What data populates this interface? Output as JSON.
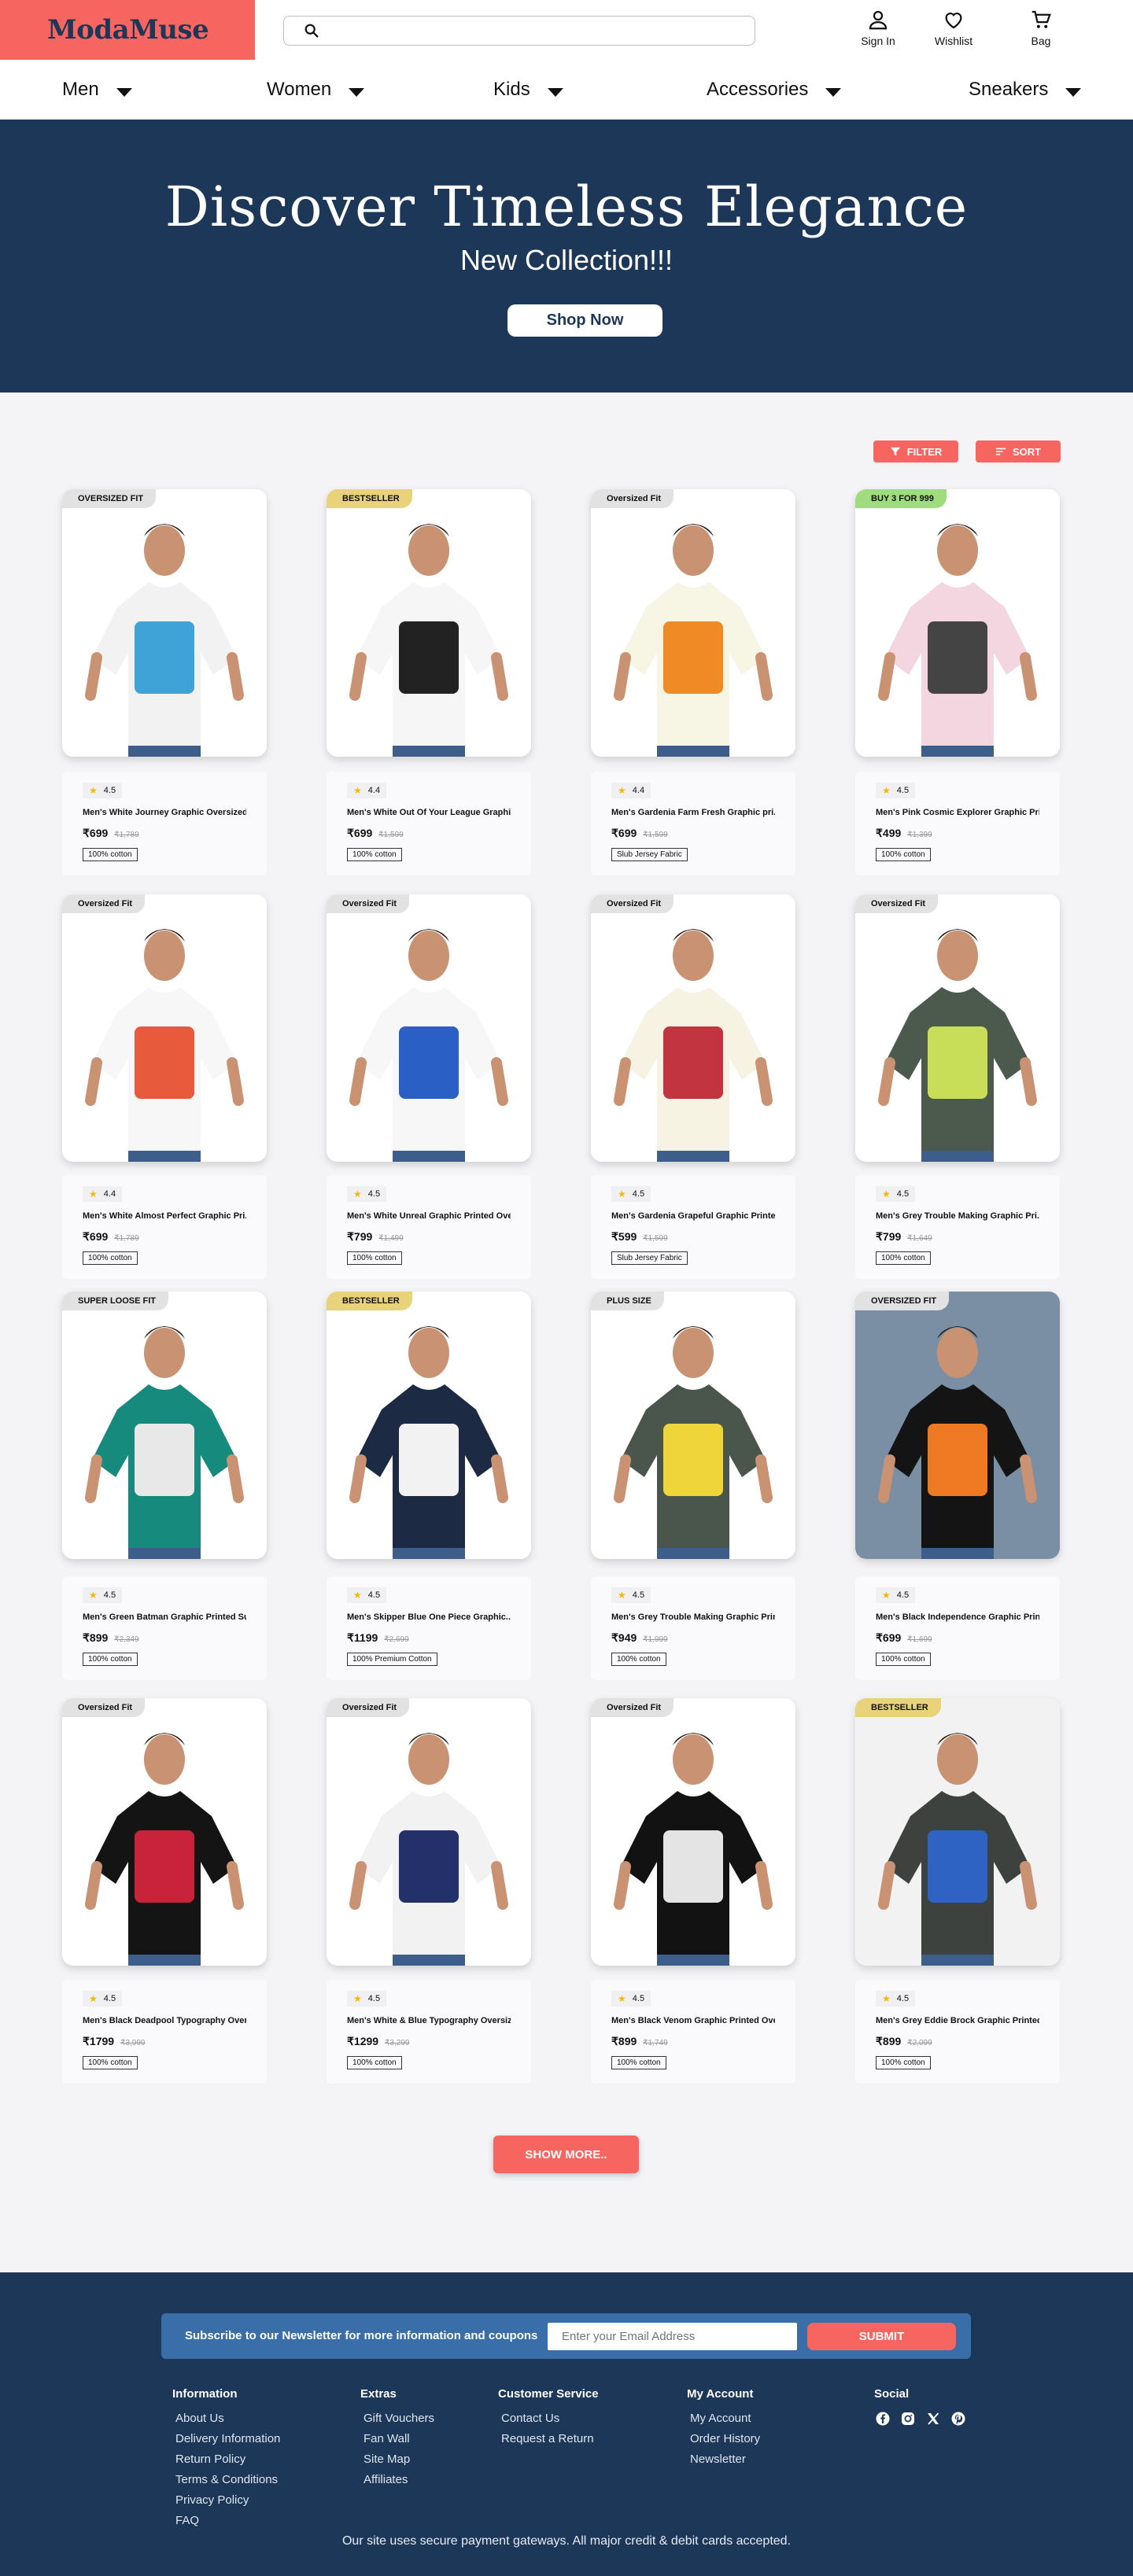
{
  "brand": {
    "logo": "ModaMuse"
  },
  "search": {
    "placeholder": ""
  },
  "header_actions": [
    {
      "label": "Sign In",
      "icon": "user-icon"
    },
    {
      "label": "Wishlist",
      "icon": "heart-icon"
    },
    {
      "label": "Bag",
      "icon": "bag-icon"
    }
  ],
  "nav": [
    {
      "label": "Men"
    },
    {
      "label": "Women"
    },
    {
      "label": "Kids"
    },
    {
      "label": "Accessories"
    },
    {
      "label": "Sneakers"
    }
  ],
  "hero": {
    "title": "Discover Timeless Elegance",
    "subtitle": "New Collection!!!",
    "button": "Shop Now"
  },
  "toolbar": {
    "filter": "FILTER",
    "sort": "SORT"
  },
  "products": [
    {
      "badge": "OVERSIZED FIT",
      "badge_color": "#e2e2e2",
      "rating": "4.5",
      "title": "Men's White Journey Graphic Oversized..",
      "price": "₹699",
      "mrp": "₹1,789",
      "tag": "100% cotton",
      "shirt": "#f2f2f2",
      "print": "#3fa3d8",
      "bg": "#ffffff"
    },
    {
      "badge": "BESTSELLER",
      "badge_color": "#e8d27a",
      "rating": "4.4",
      "title": "Men's White Out Of Your League Graphic..",
      "price": "₹699",
      "mrp": "₹1,599",
      "tag": "100% cotton",
      "shirt": "#f6f6f6",
      "print": "#222222",
      "bg": "#ffffff"
    },
    {
      "badge": "Oversized Fit",
      "badge_color": "#e2e2e2",
      "rating": "4.4",
      "title": "Men's Gardenia Farm Fresh Graphic pri..",
      "price": "₹699",
      "mrp": "₹1,599",
      "tag": "Slub Jersey Fabric",
      "shirt": "#f7f5e4",
      "print": "#f08a24",
      "bg": "#ffffff"
    },
    {
      "badge": "BUY 3 FOR 999",
      "badge_color": "#9edc7c",
      "rating": "4.5",
      "title": "Men's Pink Cosmic Explorer Graphic Pri..",
      "price": "₹499",
      "mrp": "₹1,399",
      "tag": "100% cotton",
      "shirt": "#f3d6e0",
      "print": "#444444",
      "bg": "#ffffff"
    },
    {
      "badge": "Oversized Fit",
      "badge_color": "#e2e2e2",
      "rating": "4.4",
      "title": "Men's White Almost Perfect Graphic Pri..",
      "price": "₹699",
      "mrp": "₹1,789",
      "tag": "100% cotton",
      "shirt": "#f7f7f7",
      "print": "#e85a3c",
      "bg": "#ffffff"
    },
    {
      "badge": "Oversized Fit",
      "badge_color": "#e2e2e2",
      "rating": "4.5",
      "title": "Men's White Unreal Graphic Printed Over..",
      "price": "₹799",
      "mrp": "₹1,499",
      "tag": "100% cotton",
      "shirt": "#f7f7f7",
      "print": "#2a5fc6",
      "bg": "#ffffff"
    },
    {
      "badge": "Oversized Fit",
      "badge_color": "#e2e2e2",
      "rating": "4.5",
      "title": "Men's Gardenia Grapeful Graphic Printed..",
      "price": "₹599",
      "mrp": "₹1,599",
      "tag": "Slub Jersey Fabric",
      "shirt": "#f6f3e2",
      "print": "#c2343f",
      "bg": "#ffffff"
    },
    {
      "badge": "Oversized Fit",
      "badge_color": "#e2e2e2",
      "rating": "4.5",
      "title": "Men's Grey Trouble Making Graphic Pri..",
      "price": "₹799",
      "mrp": "₹1,649",
      "tag": "100% cotton",
      "shirt": "#4b5a4d",
      "print": "#c8dd58",
      "bg": "#ffffff"
    },
    {
      "badge": "SUPER LOOSE FIT",
      "badge_color": "#e2e2e2",
      "rating": "4.5",
      "title": "Men's Green Batman Graphic Printed Su..",
      "price": "₹899",
      "mrp": "₹2,349",
      "tag": "100% cotton",
      "shirt": "#168a7c",
      "print": "#e8e8e8",
      "bg": "#ffffff"
    },
    {
      "badge": "BESTSELLER",
      "badge_color": "#e8d27a",
      "rating": "4.5",
      "title": "Men's Skipper Blue One Piece Graphic..",
      "price": "₹1199",
      "mrp": "₹2,699",
      "tag": "100% Premium Cotton",
      "shirt": "#1d2a44",
      "print": "#f2f2f2",
      "bg": "#ffffff"
    },
    {
      "badge": "PLUS SIZE",
      "badge_color": "#e2e2e2",
      "rating": "4.5",
      "title": "Men's Grey Trouble Making Graphic Prin..",
      "price": "₹949",
      "mrp": "₹1,999",
      "tag": "100% cotton",
      "shirt": "#4a554c",
      "print": "#f0d53a",
      "bg": "#ffffff"
    },
    {
      "badge": "OVERSIZED FIT",
      "badge_color": "#e2e2e2",
      "rating": "4.5",
      "title": "Men's Black Independence Graphic Print..",
      "price": "₹699",
      "mrp": "₹1,699",
      "tag": "100% cotton",
      "shirt": "#141414",
      "print": "#f07a23",
      "bg": "#7a8fa3"
    },
    {
      "badge": "Oversized Fit",
      "badge_color": "#e2e2e2",
      "rating": "4.5",
      "title": "Men's Black Deadpool Typography Over..",
      "price": "₹1799",
      "mrp": "₹3,999",
      "tag": "100% cotton",
      "shirt": "#141414",
      "print": "#c8233b",
      "bg": "#ffffff"
    },
    {
      "badge": "Oversized Fit",
      "badge_color": "#e2e2e2",
      "rating": "4.5",
      "title": "Men's White & Blue Typography Oversiz..",
      "price": "₹1299",
      "mrp": "₹3,299",
      "tag": "100% cotton",
      "shirt": "#f2f2f2",
      "print": "#23306a",
      "bg": "#ffffff"
    },
    {
      "badge": "Oversized Fit",
      "badge_color": "#e2e2e2",
      "rating": "4.5",
      "title": "Men's Black Venom Graphic Printed Ove..",
      "price": "₹899",
      "mrp": "₹1,749",
      "tag": "100% cotton",
      "shirt": "#121212",
      "print": "#e4e4e4",
      "bg": "#ffffff"
    },
    {
      "badge": "BESTSELLER",
      "badge_color": "#e8d27a",
      "rating": "4.5",
      "title": "Men's Grey Eddie Brock Graphic Printed..",
      "price": "₹899",
      "mrp": "₹2,099",
      "tag": "100% cotton",
      "shirt": "#3d423e",
      "print": "#2e63c4",
      "bg": "#f2f2f2"
    }
  ],
  "show_more": "SHOW MORE..",
  "footer": {
    "newsletter_text": "Subscribe to our Newsletter for more information and coupons",
    "email_placeholder": "Enter your Email Address",
    "submit": "SUBMIT",
    "columns": [
      {
        "heading": "Information",
        "links": [
          "About Us",
          "Delivery Information",
          "Return Policy",
          "Terms & Conditions",
          "Privacy Policy",
          "FAQ"
        ]
      },
      {
        "heading": "Extras",
        "links": [
          "Gift Vouchers",
          "Fan Wall",
          "Site Map",
          "Affiliates"
        ]
      },
      {
        "heading": "Customer Service",
        "links": [
          "Contact Us",
          "Request a Return"
        ]
      },
      {
        "heading": "My Account",
        "links": [
          "My Account",
          "Order History",
          "Newsletter"
        ]
      }
    ],
    "social_heading": "Social",
    "social_icons": [
      "facebook-icon",
      "instagram-icon",
      "x-icon",
      "pinterest-icon"
    ],
    "note": "Our site uses secure payment gateways. All major credit & debit cards accepted."
  },
  "colors": {
    "accent": "#f76561",
    "navy": "#1c3757",
    "newsletter": "#3a6ea8",
    "star": "#f5b800"
  }
}
